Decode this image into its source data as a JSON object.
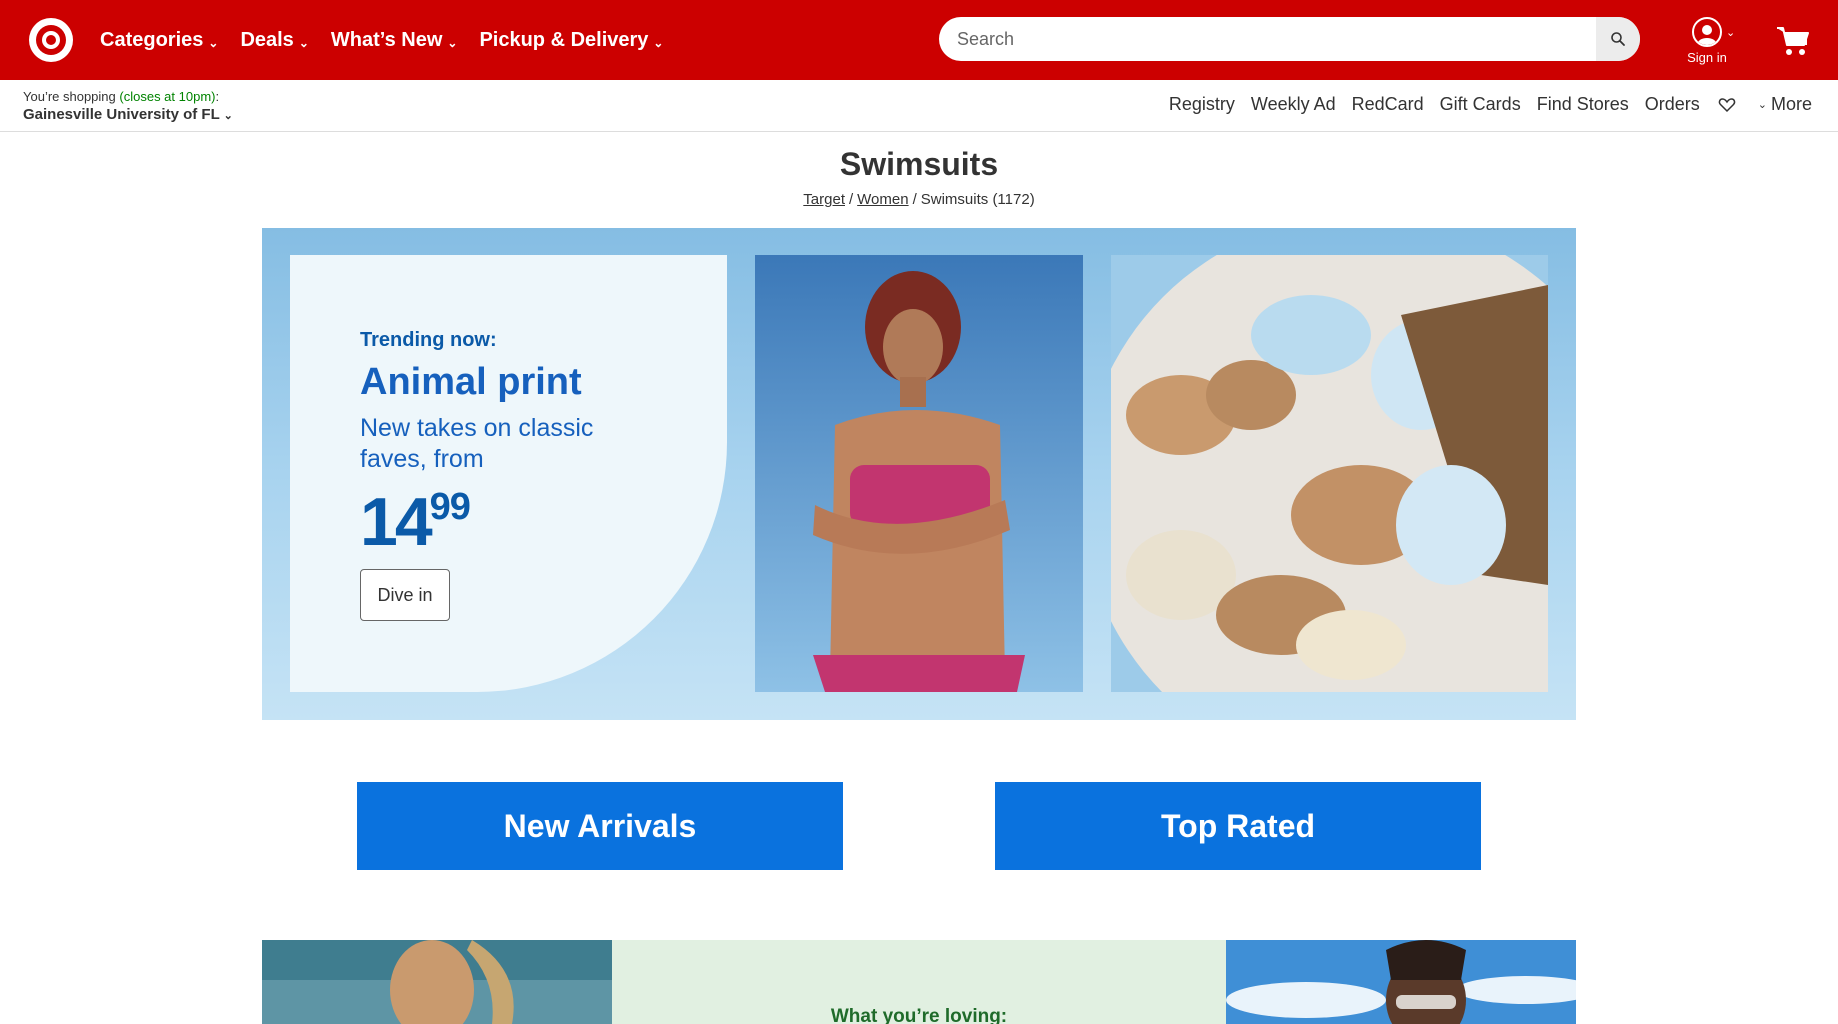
{
  "header": {
    "nav": [
      {
        "label": "Categories"
      },
      {
        "label": "Deals"
      },
      {
        "label": "What’s New"
      },
      {
        "label": "Pickup & Delivery"
      }
    ],
    "search_placeholder": "Search",
    "account_label": "Sign in",
    "brand_color": "#cc0000"
  },
  "store": {
    "prefix": "You’re shopping",
    "closes": "(closes at 10pm)",
    "suffix": ":",
    "name": "Gainesville University of FL"
  },
  "utility_links": [
    "Registry",
    "Weekly Ad",
    "RedCard",
    "Gift Cards",
    "Find Stores",
    "Orders"
  ],
  "more_label": "More",
  "page": {
    "title": "Swimsuits",
    "breadcrumb": {
      "crumb1": "Target",
      "crumb2": "Women",
      "current": "Swimsuits (1172)"
    }
  },
  "hero": {
    "eyebrow": "Trending now:",
    "headline": "Animal print",
    "subtext": "New takes on classic faves, from",
    "price_dollars": "14",
    "price_cents": "99",
    "button": "Dive in"
  },
  "ctas": {
    "new_arrivals": "New Arrivals",
    "top_rated": "Top Rated"
  },
  "bottom": {
    "heading": "What you’re loving:"
  }
}
